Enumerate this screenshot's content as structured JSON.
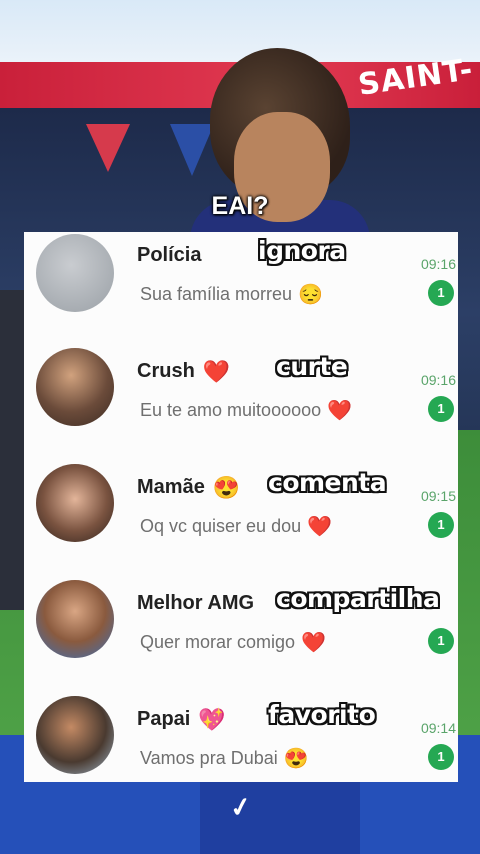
{
  "caption": "EAI?",
  "stadium_banner": "SAINT-",
  "chats": [
    {
      "name": "Polícia",
      "name_emoji": "",
      "preview": "Sua família morreu",
      "preview_emoji": "😔",
      "time": "09:16",
      "unread": "1",
      "action": "ignora",
      "avatar_icon": "blank-avatar-icon"
    },
    {
      "name": "Crush",
      "name_emoji": "❤️",
      "preview": "Eu te amo muitoooooo",
      "preview_emoji": "❤️",
      "time": "09:16",
      "unread": "1",
      "action": "curte",
      "avatar_icon": "person-photo-icon"
    },
    {
      "name": "Mamãe",
      "name_emoji": "😍",
      "preview": "Oq vc quiser eu dou",
      "preview_emoji": "❤️",
      "time": "09:15",
      "unread": "1",
      "action": "comenta",
      "avatar_icon": "person-photo-icon"
    },
    {
      "name": "Melhor AMG",
      "name_emoji": "",
      "preview": "Quer morar comigo",
      "preview_emoji": "❤️",
      "time": "",
      "unread": "1",
      "action": "compartilha",
      "avatar_icon": "person-photo-icon"
    },
    {
      "name": "Papai",
      "name_emoji": "💖",
      "preview": "Vamos pra Dubai",
      "preview_emoji": "😍",
      "time": "09:14",
      "unread": "1",
      "action": "favorito",
      "avatar_icon": "person-photo-icon"
    }
  ],
  "colors": {
    "badge": "#25a853",
    "time": "#5aa46a",
    "heart": "#e0243a"
  }
}
